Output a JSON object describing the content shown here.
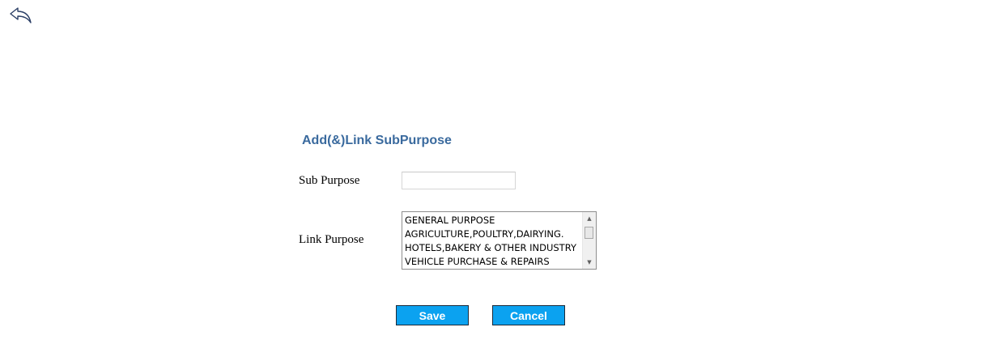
{
  "header": {
    "back_icon": "back-arrow-icon"
  },
  "form": {
    "title": "Add(&)Link SubPurpose",
    "sub_purpose_label": "Sub Purpose",
    "sub_purpose_value": "",
    "link_purpose_label": "Link Purpose",
    "link_purpose_options": [
      "GENERAL PURPOSE",
      "AGRICULTURE,POULTRY,DAIRYING.",
      "HOTELS,BAKERY & OTHER INDUSTRY",
      "VEHICLE PURCHASE & REPAIRS"
    ]
  },
  "actions": {
    "save_label": "Save",
    "cancel_label": "Cancel"
  },
  "colors": {
    "title": "#3a6a9e",
    "button_bg": "#0ba2f0",
    "button_text": "#ffffff"
  }
}
